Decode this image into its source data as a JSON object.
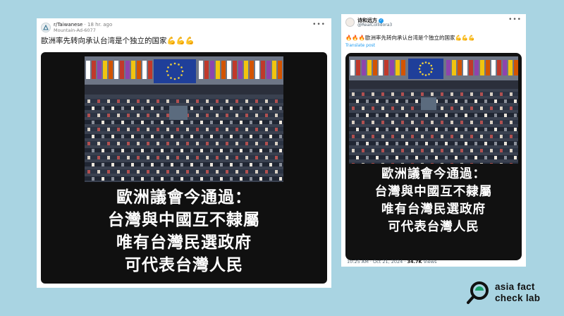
{
  "reddit_post": {
    "subreddit": "r/Taiwanese",
    "separator": "·",
    "time": "18 hr. ago",
    "username": "Mountain-Ad-6077",
    "more_icon": "more-horizontal-icon",
    "title": "歐洲率先转向承认台湾是个独立的国家💪💪💪",
    "image_caption": [
      "歐洲議會今通過：",
      "台灣與中國互不隸屬",
      "唯有台灣民選政府",
      "可代表台灣人民"
    ]
  },
  "x_post": {
    "display_name": "诗和远方",
    "verified_icon": "verified-badge-icon",
    "handle": "@RealCollidora3",
    "text": "🔥🔥🔥歐洲率先转向承认台湾是个独立的国家💪💪💪",
    "translate_label": "Translate post",
    "image_caption": [
      "歐洲議會今通過：",
      "台灣與中國互不隸屬",
      "唯有台灣民選政府",
      "可代表台灣人民"
    ],
    "timestamp": "10:25 AM · Oct 21, 2024 · ",
    "views_count": "34.7K",
    "views_label": " Views"
  },
  "logo": {
    "line1": "asia fact",
    "line2": "check lab"
  },
  "colors": {
    "background": "#a9d4e2",
    "eu_blue": "#1f3f9a",
    "eu_stars": "#f3d23a",
    "link": "#1d9bf0"
  }
}
